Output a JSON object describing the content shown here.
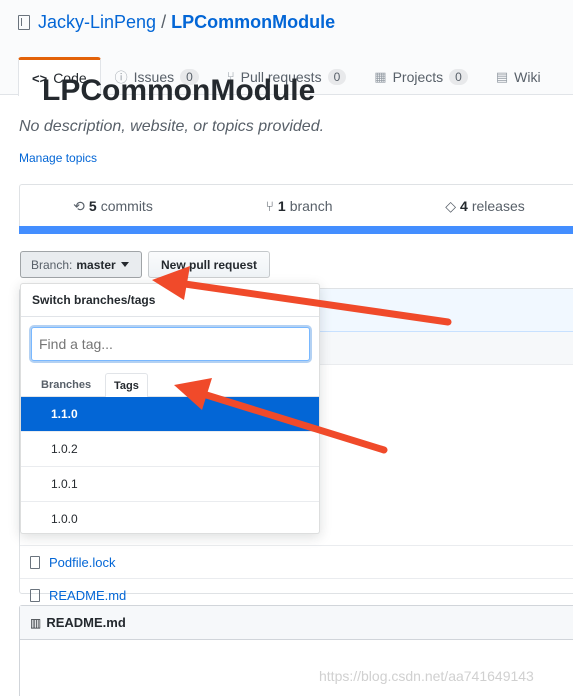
{
  "repo": {
    "owner": "Jacky-LinPeng",
    "separator": "/",
    "name": "LPCommonModule"
  },
  "tabs": [
    {
      "icon": "<>",
      "label": "Code",
      "count": ""
    },
    {
      "icon": "ⓘ",
      "label": "Issues",
      "count": "0"
    },
    {
      "icon": "⑂",
      "label": "Pull requests",
      "count": "0"
    },
    {
      "icon": "▦",
      "label": "Projects",
      "count": "0"
    },
    {
      "icon": "▤",
      "label": "Wiki",
      "count": ""
    }
  ],
  "description": "No description, website, or topics provided.",
  "manage_topics": "Manage topics",
  "summary": {
    "commits_num": "5",
    "commits_label": "commits",
    "branch_num": "1",
    "branch_label": "branch",
    "releases_num": "4",
    "releases_label": "releases"
  },
  "branch_button": {
    "prefix": "Branch:",
    "value": "master"
  },
  "new_pr_button": "New pull request",
  "dropdown": {
    "title": "Switch branches/tags",
    "filter_placeholder": "Find a tag...",
    "tab_branches": "Branches",
    "tab_tags": "Tags",
    "items": [
      "1.1.0",
      "1.0.2",
      "1.0.1",
      "1.0.0"
    ],
    "selected": "1.1.0"
  },
  "files": [
    "Podfile.lock",
    "README.md"
  ],
  "readme": {
    "header": "README.md",
    "heading": "LPCommonModule"
  },
  "watermark": "https://blog.csdn.net/aa741649143",
  "colors": {
    "accent": "#0366d6",
    "arrow": "#f04a2a",
    "tab_border": "#e36209"
  }
}
